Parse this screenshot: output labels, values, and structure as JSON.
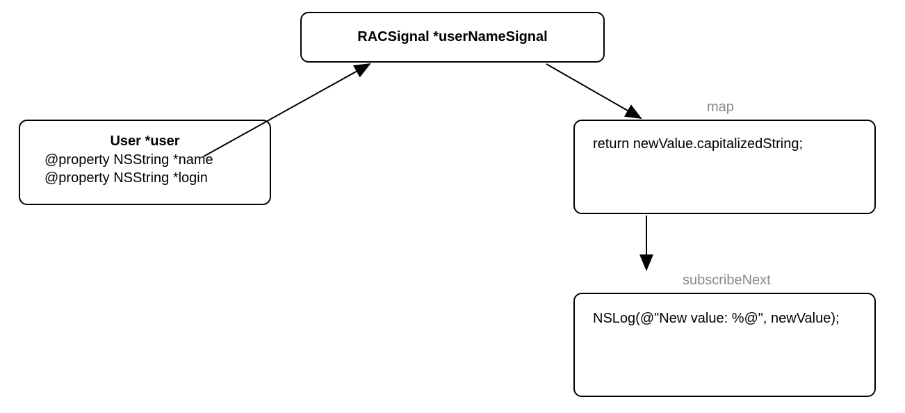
{
  "nodes": {
    "signal": {
      "title": "RACSignal *userNameSignal"
    },
    "user": {
      "title": "User *user",
      "prop1": "@property NSString *name",
      "prop2": "@property NSString *login"
    },
    "map": {
      "label": "map",
      "body": "return newValue.capitalizedString;"
    },
    "subscribe": {
      "label": "subscribeNext",
      "body": "NSLog(@\"New value: %@\", newValue);"
    }
  }
}
